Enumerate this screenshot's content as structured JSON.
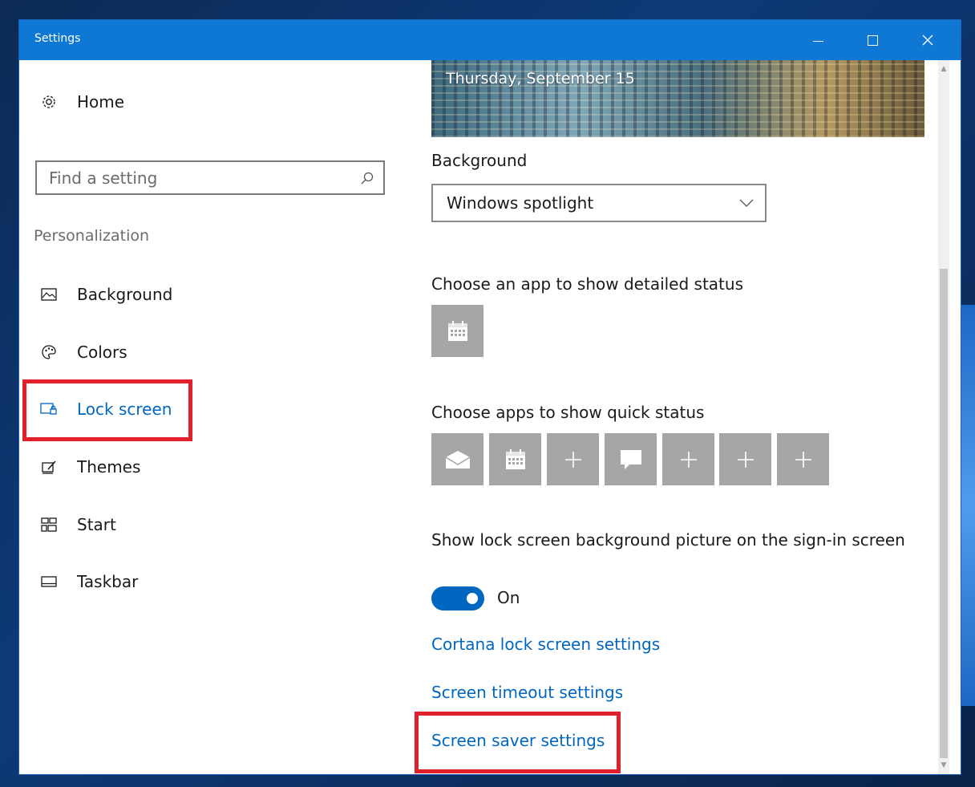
{
  "window": {
    "title": "Settings"
  },
  "sidebar": {
    "home_label": "Home",
    "search_placeholder": "Find a setting",
    "section_label": "Personalization",
    "items": [
      {
        "label": "Background",
        "icon": "picture-icon"
      },
      {
        "label": "Colors",
        "icon": "palette-icon"
      },
      {
        "label": "Lock screen",
        "icon": "lock-screen-icon",
        "active": true
      },
      {
        "label": "Themes",
        "icon": "themes-icon"
      },
      {
        "label": "Start",
        "icon": "start-icon"
      },
      {
        "label": "Taskbar",
        "icon": "taskbar-icon"
      }
    ]
  },
  "content": {
    "preview_date": "Thursday, September 15",
    "background_label": "Background",
    "background_value": "Windows spotlight",
    "detailed_status_label": "Choose an app to show detailed status",
    "quick_status_label": "Choose apps to show quick status",
    "quick_status_tiles": [
      "mail-icon",
      "calendar-icon",
      "plus-icon",
      "message-icon",
      "plus-icon",
      "plus-icon",
      "plus-icon"
    ],
    "signin_label": "Show lock screen background picture on the sign-in screen",
    "toggle_state": "On",
    "links": {
      "cortana": "Cortana lock screen settings",
      "timeout": "Screen timeout settings",
      "screensaver": "Screen saver settings"
    }
  },
  "colors": {
    "accent": "#0067c0",
    "titlebar": "#0f78d4",
    "highlight": "#e2202b",
    "tile": "#a6a6a6"
  }
}
